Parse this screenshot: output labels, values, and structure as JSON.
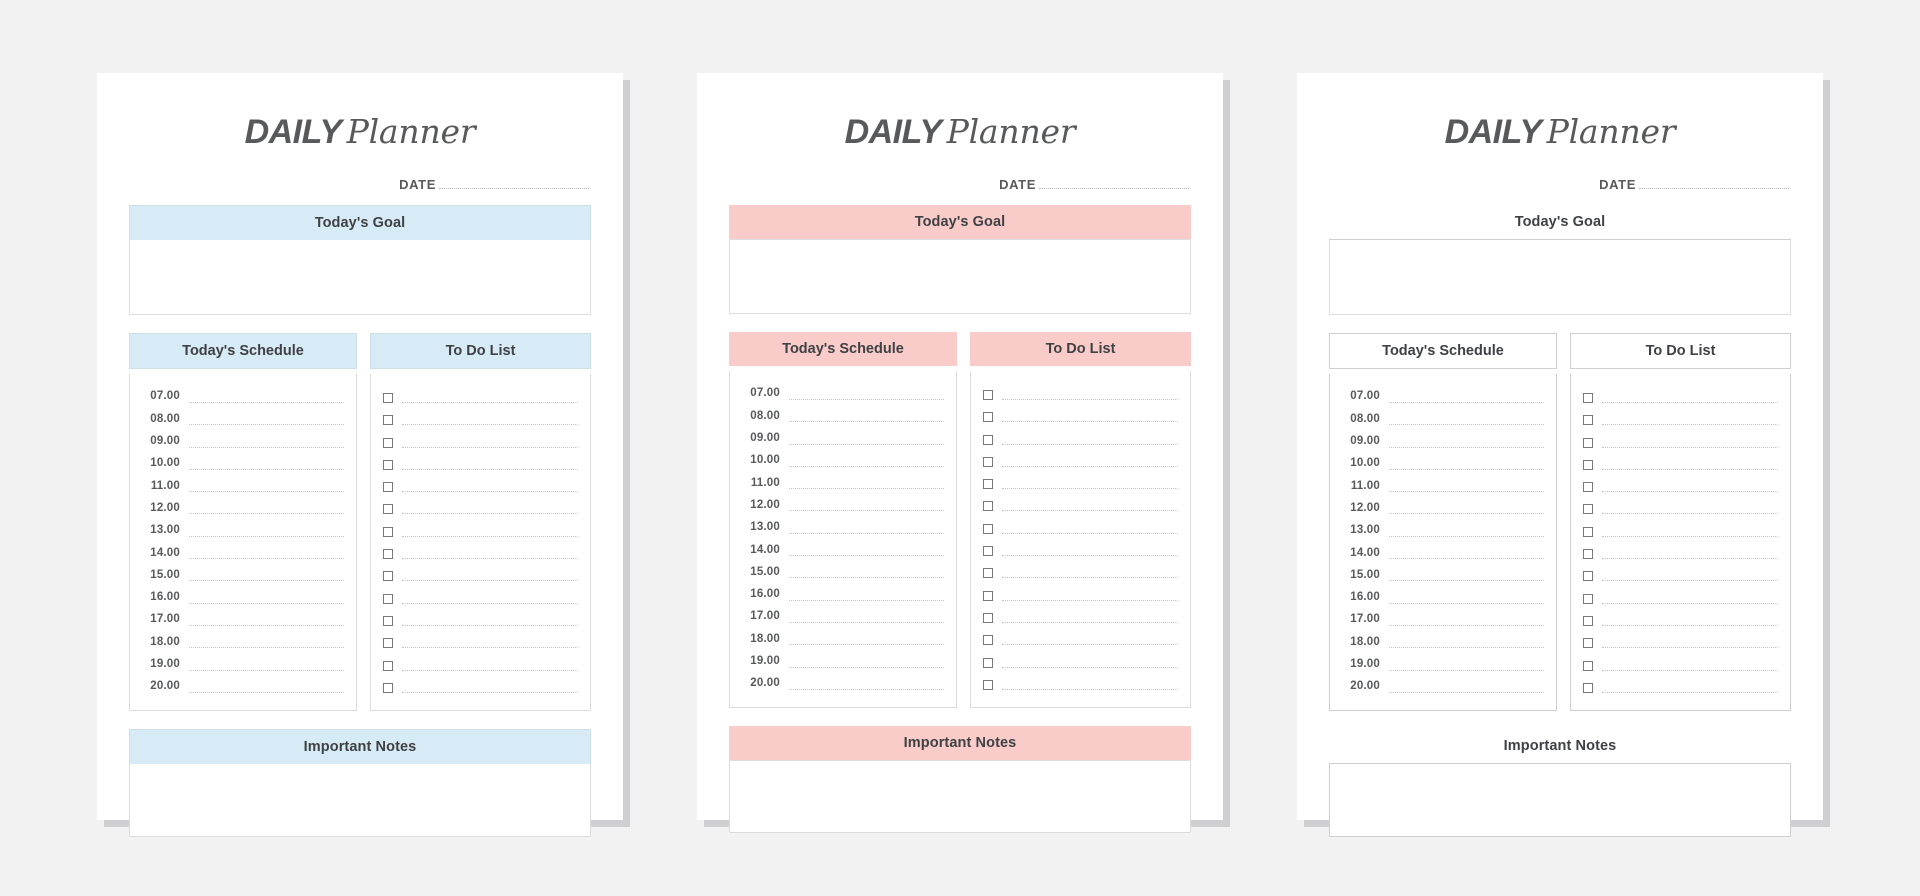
{
  "page": {
    "background": "#f2f2f3",
    "card_background": "#ffffff",
    "shadow_color": "#cfcfd1"
  },
  "title": {
    "part_bold": "DAILY",
    "part_script": "Planner",
    "color": "#58595b"
  },
  "date": {
    "label": "DATE",
    "value": ""
  },
  "sections": {
    "goal": "Today's Goal",
    "schedule": "Today's Schedule",
    "todo": "To Do List",
    "notes": "Important Notes"
  },
  "schedule_times": [
    "07.00",
    "08.00",
    "09.00",
    "10.00",
    "11.00",
    "12.00",
    "13.00",
    "14.00",
    "15.00",
    "16.00",
    "17.00",
    "18.00",
    "19.00",
    "20.00"
  ],
  "todo_row_count": 14,
  "variants": [
    {
      "id": "blue",
      "theme_class": "theme-blue",
      "accent": "#d6ebf6",
      "accent_border": "#cfdfe7"
    },
    {
      "id": "pink",
      "theme_class": "theme-pink",
      "accent": "#f9ccc9",
      "accent_border": "#f9ccc9"
    },
    {
      "id": "plain",
      "theme_class": "theme-plain",
      "accent": "#ffffff",
      "accent_border": "#cfcfd1"
    }
  ]
}
